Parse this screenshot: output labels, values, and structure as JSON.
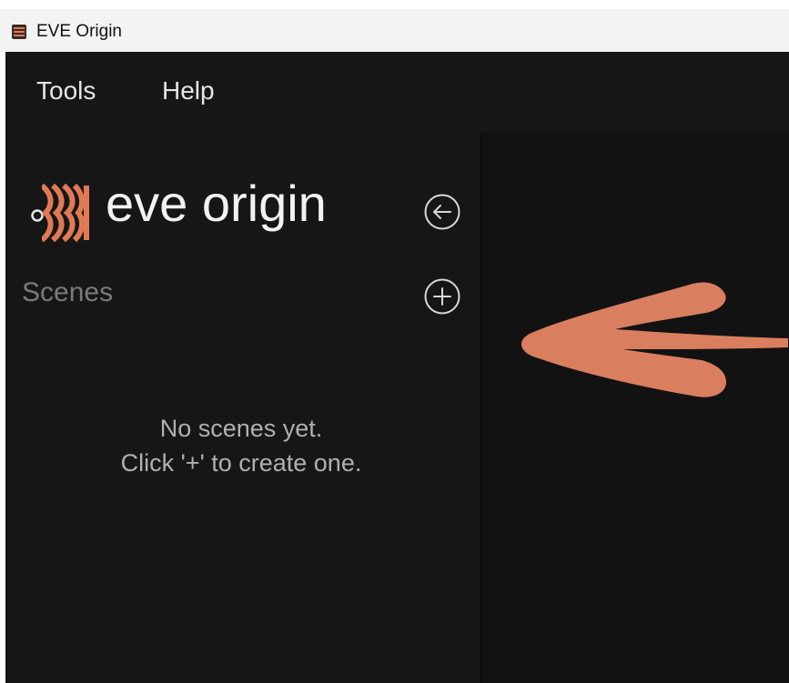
{
  "window": {
    "title": "EVE Origin"
  },
  "menu": {
    "items": [
      "Tools",
      "Help"
    ]
  },
  "sidebar": {
    "brand": "eve origin",
    "section_title": "Scenes",
    "empty_state": {
      "line1": "No scenes yet.",
      "line2": "Click '+' to create one."
    },
    "collapse_icon": "arrow-left-circle-icon",
    "add_icon": "plus-circle-icon"
  },
  "annotation": {
    "icon": "arrow-left-annotation",
    "color": "#d97f5f"
  },
  "colors": {
    "background": "#161616",
    "accent": "#e07a55",
    "text": "#e6e6e6",
    "muted": "#7a7a7a"
  }
}
